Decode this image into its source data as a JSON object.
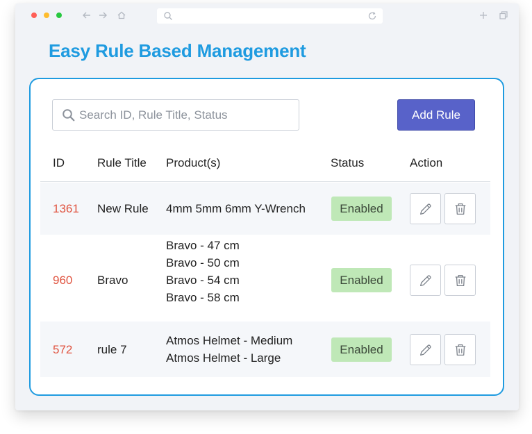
{
  "page": {
    "title": "Easy Rule Based Management"
  },
  "search": {
    "placeholder": "Search ID, Rule Title, Status",
    "value": ""
  },
  "toolbar": {
    "add_rule_label": "Add Rule"
  },
  "table": {
    "headers": {
      "id": "ID",
      "title": "Rule Title",
      "products": "Product(s)",
      "status": "Status",
      "action": "Action"
    },
    "rows": [
      {
        "id": "1361",
        "title": "New Rule",
        "products": [
          "4mm 5mm 6mm Y-Wrench"
        ],
        "status": "Enabled"
      },
      {
        "id": "960",
        "title": "Bravo",
        "products": [
          "Bravo - 47 cm",
          "Bravo - 50 cm",
          "Bravo - 54 cm",
          "Bravo - 58 cm"
        ],
        "status": "Enabled"
      },
      {
        "id": "572",
        "title": "rule 7",
        "products": [
          "Atmos Helmet - Medium",
          "Atmos Helmet - Large"
        ],
        "status": "Enabled"
      }
    ]
  },
  "icons": {
    "edit": "pencil-icon",
    "delete": "trash-icon",
    "search": "search-icon"
  },
  "colors": {
    "accent": "#1f9be0",
    "button": "#5862c9",
    "id_text": "#e0533f",
    "status_bg": "#bfe8b7"
  }
}
